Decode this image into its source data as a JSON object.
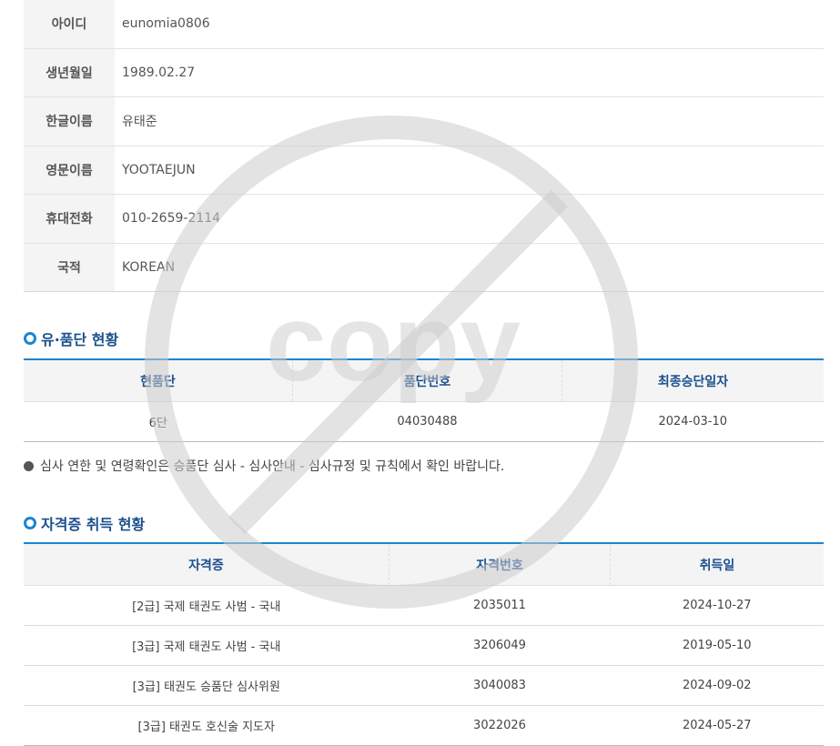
{
  "profile": [
    {
      "label": "아이디",
      "value": "eunomia0806"
    },
    {
      "label": "생년월일",
      "value": "1989.02.27"
    },
    {
      "label": "한글이름",
      "value": "유태준"
    },
    {
      "label": "영문이름",
      "value": "YOOTAEJUN"
    },
    {
      "label": "휴대전화",
      "value": "010-2659-2114"
    },
    {
      "label": "국적",
      "value": "KOREAN"
    }
  ],
  "dan_section": {
    "title": "유·품단 현황",
    "headers": [
      "현품단",
      "품단번호",
      "최종승단일자"
    ],
    "rows": [
      [
        "6단",
        "04030488",
        "2024-03-10"
      ]
    ]
  },
  "notice": "심사 연한 및 연령확인은 승품단 심사 - 심사안내 - 심사규정 및 규칙에서 확인 바랍니다.",
  "cert_section": {
    "title": "자격증 취득 현황",
    "headers": [
      "자격증",
      "자격번호",
      "취득일"
    ],
    "rows": [
      [
        "[2급] 국제 태권도 사범 - 국내",
        "2035011",
        "2024-10-27"
      ],
      [
        "[3급] 국제 태권도 사범 - 국내",
        "3206049",
        "2019-05-10"
      ],
      [
        "[3급] 태권도 승품단 심사위원",
        "3040083",
        "2024-09-02"
      ],
      [
        "[3급] 태권도 호신술 지도자",
        "3022026",
        "2024-05-27"
      ]
    ]
  },
  "watermark": {
    "text": "copy",
    "color": "#cccccc"
  },
  "colors": {
    "accent": "#1a86d0",
    "title": "#1b4f8e"
  }
}
